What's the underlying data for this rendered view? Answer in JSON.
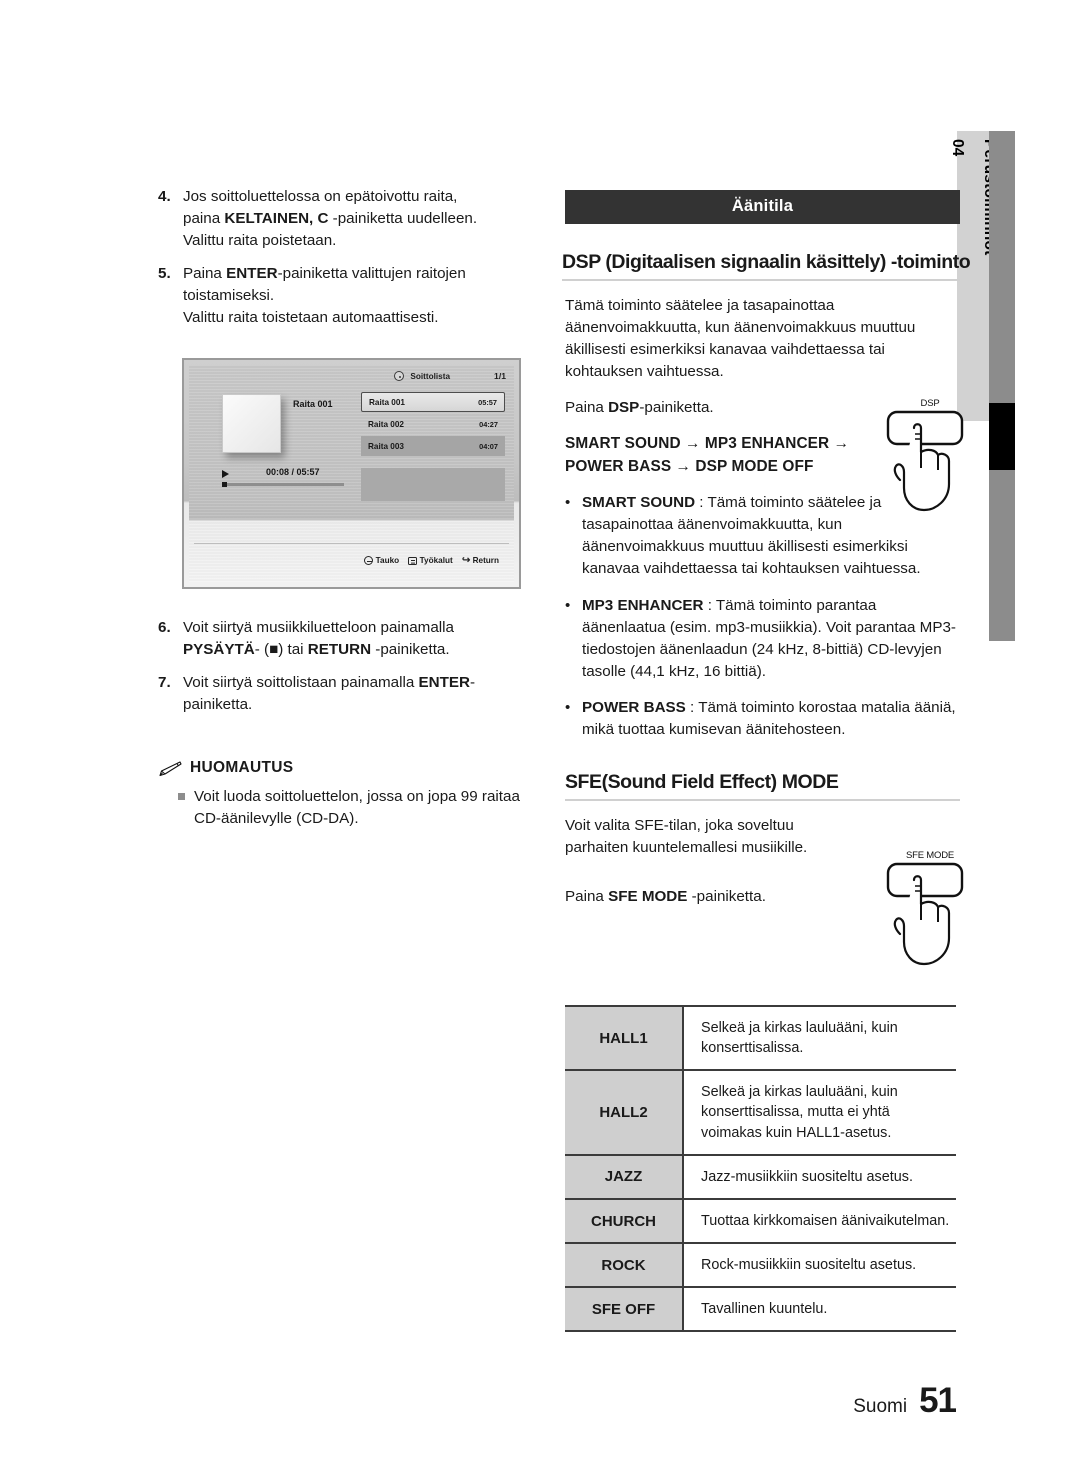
{
  "margin_tab": {
    "chapter_number": "04",
    "chapter_title": "Perustoiminnot"
  },
  "left_column": {
    "steps": [
      {
        "number": "4.",
        "line1_a": "Jos soittoluettelossa on epätoivottu raita,",
        "line2_a": "paina ",
        "line2_bold": "KELTAINEN, C",
        "line2_b": " -painiketta uudelleen.",
        "line3": "Valittu raita poistetaan."
      },
      {
        "number": "5.",
        "line1_a": "Paina ",
        "line1_bold": "ENTER",
        "line1_b": "-painiketta valittujen raitojen",
        "line2": "toistamiseksi.",
        "sub": "Valittu raita toistetaan automaattisesti."
      }
    ],
    "steps_after": [
      {
        "number": "6.",
        "pre": "Voit siirtyä musiikkiluetteloon painamalla",
        "bold1": "PYSÄYTÄ",
        "mid1": "- (■) tai ",
        "bold2": "RETURN",
        "post": " -painiketta."
      },
      {
        "number": "7.",
        "pre": "Voit siirtyä soittolistaan painamalla ",
        "bold1": "ENTER",
        "post": "-",
        "line2": "painiketta."
      }
    ],
    "note": {
      "icon": "pencil-icon",
      "title": "HUOMAUTUS",
      "items": [
        "Voit luoda soittoluettelon, jossa on jopa 99 raitaa CD-äänilevylle (CD-DA)."
      ]
    }
  },
  "player_screenshot": {
    "disc_icon": "disc-icon",
    "title": "Soittolista",
    "page_indicator": "1/1",
    "now_playing_label": "Raita 001",
    "tracks": [
      {
        "name": "Raita 001",
        "time": "05:57",
        "state": "selected"
      },
      {
        "name": "Raita 002",
        "time": "04:27",
        "state": "normal"
      },
      {
        "name": "Raita 003",
        "time": "04:07",
        "state": "highlighted"
      }
    ],
    "play_icon": "play-icon",
    "progress_time": "00:08 / 05:57",
    "footer_buttons": [
      {
        "icon": "enter-icon",
        "label": "Tauko"
      },
      {
        "icon": "tools-icon",
        "label": "Työkalut"
      },
      {
        "icon": "return-icon",
        "label": "Return"
      }
    ]
  },
  "right_column": {
    "section_bar": "Äänitila",
    "dsp": {
      "heading": "DSP (Digitaalisen signaalin käsittely) -toiminto",
      "intro": "Tämä toiminto säätelee ja tasapainottaa äänenvoimakkuutta, kun äänenvoimakkuus muuttuu äkillisesti esimerkiksi kanavaa vaihdettaessa tai kohtauksen vaihtuessa.",
      "press_pre": "Paina ",
      "press_bold": "DSP",
      "press_post": "-painiketta.",
      "chain_line1": "SMART SOUND  → MP3 ENHANCER →",
      "chain_line2": "POWER BASS  →  DSP MODE OFF",
      "button_caption": "DSP",
      "bullets": [
        {
          "term": "SMART SOUND",
          "sep": " : ",
          "text": "Tämä toiminto säätelee ja tasapainottaa äänenvoimakkuutta, kun äänenvoimakkuus muuttuu äkillisesti esimerkiksi kanavaa vaihdettaessa tai kohtauksen vaihtuessa."
        },
        {
          "term": "MP3 ENHANCER",
          "sep": "  : ",
          "text": "Tämä toiminto parantaa äänenlaatua (esim. mp3-musiikkia). Voit parantaa MP3-tiedostojen äänenlaadun (24 kHz, 8-bittiä) CD-levyjen tasolle (44,1 kHz, 16 bittiä)."
        },
        {
          "term": "POWER BASS",
          "sep": " : ",
          "text": "Tämä toiminto korostaa matalia ääniä, mikä tuottaa kumisevan äänitehosteen."
        }
      ]
    },
    "sfe": {
      "heading": "SFE(Sound Field Effect) MODE",
      "intro": "Voit valita SFE-tilan, joka soveltuu parhaiten kuuntelemallesi musiikille.",
      "press_pre": "Paina ",
      "press_bold": "SFE MODE",
      "press_post": " -painiketta.",
      "button_caption": "SFE MODE",
      "table": [
        {
          "key": "HALL1",
          "value": "Selkeä ja kirkas lauluääni, kuin konserttisalissa."
        },
        {
          "key": "HALL2",
          "value": "Selkeä ja kirkas lauluääni, kuin konserttisalissa, mutta ei yhtä voimakas kuin HALL1-asetus."
        },
        {
          "key": "JAZZ",
          "value": "Jazz-musiikkiin suositeltu asetus."
        },
        {
          "key": "CHURCH",
          "value": "Tuottaa kirkkomaisen äänivaikutelman."
        },
        {
          "key": "ROCK",
          "value": "Rock-musiikkiin suositeltu asetus."
        },
        {
          "key": "SFE OFF",
          "value": "Tavallinen kuuntelu."
        }
      ]
    }
  },
  "footer": {
    "language": "Suomi",
    "page_number": "51"
  },
  "colors": {
    "section_bar_bg": "#333333",
    "table_key_bg": "#cfcfcf",
    "margin_tab_bg": "#d2d2d2",
    "margin_bar_bg": "#8c8c8c",
    "margin_bar_active": "#000000"
  }
}
